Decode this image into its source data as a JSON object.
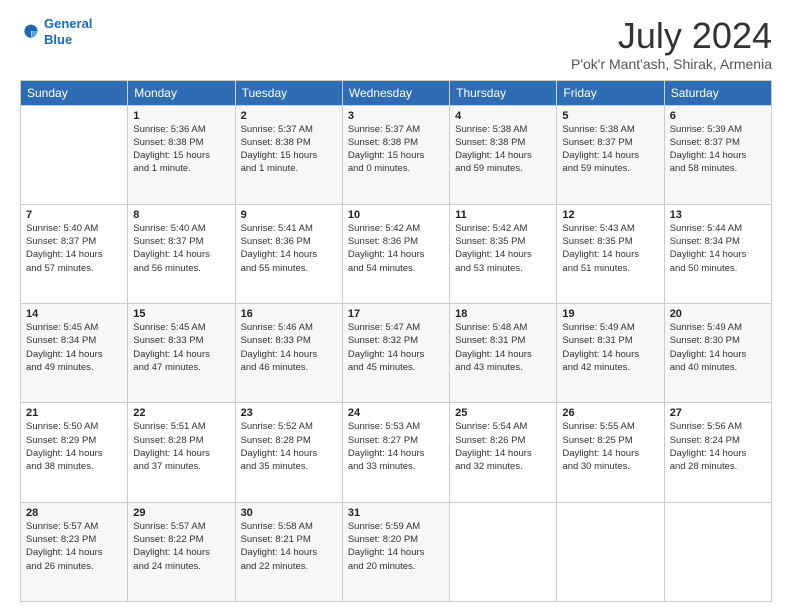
{
  "logo": {
    "line1": "General",
    "line2": "Blue"
  },
  "title": "July 2024",
  "subtitle": "P'ok'r Mant'ash, Shirak, Armenia",
  "days_of_week": [
    "Sunday",
    "Monday",
    "Tuesday",
    "Wednesday",
    "Thursday",
    "Friday",
    "Saturday"
  ],
  "weeks": [
    [
      {
        "day": "",
        "sunrise": "",
        "sunset": "",
        "daylight": ""
      },
      {
        "day": "1",
        "sunrise": "Sunrise: 5:36 AM",
        "sunset": "Sunset: 8:38 PM",
        "daylight": "Daylight: 15 hours and 1 minute."
      },
      {
        "day": "2",
        "sunrise": "Sunrise: 5:37 AM",
        "sunset": "Sunset: 8:38 PM",
        "daylight": "Daylight: 15 hours and 1 minute."
      },
      {
        "day": "3",
        "sunrise": "Sunrise: 5:37 AM",
        "sunset": "Sunset: 8:38 PM",
        "daylight": "Daylight: 15 hours and 0 minutes."
      },
      {
        "day": "4",
        "sunrise": "Sunrise: 5:38 AM",
        "sunset": "Sunset: 8:38 PM",
        "daylight": "Daylight: 14 hours and 59 minutes."
      },
      {
        "day": "5",
        "sunrise": "Sunrise: 5:38 AM",
        "sunset": "Sunset: 8:37 PM",
        "daylight": "Daylight: 14 hours and 59 minutes."
      },
      {
        "day": "6",
        "sunrise": "Sunrise: 5:39 AM",
        "sunset": "Sunset: 8:37 PM",
        "daylight": "Daylight: 14 hours and 58 minutes."
      }
    ],
    [
      {
        "day": "7",
        "sunrise": "Sunrise: 5:40 AM",
        "sunset": "Sunset: 8:37 PM",
        "daylight": "Daylight: 14 hours and 57 minutes."
      },
      {
        "day": "8",
        "sunrise": "Sunrise: 5:40 AM",
        "sunset": "Sunset: 8:37 PM",
        "daylight": "Daylight: 14 hours and 56 minutes."
      },
      {
        "day": "9",
        "sunrise": "Sunrise: 5:41 AM",
        "sunset": "Sunset: 8:36 PM",
        "daylight": "Daylight: 14 hours and 55 minutes."
      },
      {
        "day": "10",
        "sunrise": "Sunrise: 5:42 AM",
        "sunset": "Sunset: 8:36 PM",
        "daylight": "Daylight: 14 hours and 54 minutes."
      },
      {
        "day": "11",
        "sunrise": "Sunrise: 5:42 AM",
        "sunset": "Sunset: 8:35 PM",
        "daylight": "Daylight: 14 hours and 53 minutes."
      },
      {
        "day": "12",
        "sunrise": "Sunrise: 5:43 AM",
        "sunset": "Sunset: 8:35 PM",
        "daylight": "Daylight: 14 hours and 51 minutes."
      },
      {
        "day": "13",
        "sunrise": "Sunrise: 5:44 AM",
        "sunset": "Sunset: 8:34 PM",
        "daylight": "Daylight: 14 hours and 50 minutes."
      }
    ],
    [
      {
        "day": "14",
        "sunrise": "Sunrise: 5:45 AM",
        "sunset": "Sunset: 8:34 PM",
        "daylight": "Daylight: 14 hours and 49 minutes."
      },
      {
        "day": "15",
        "sunrise": "Sunrise: 5:45 AM",
        "sunset": "Sunset: 8:33 PM",
        "daylight": "Daylight: 14 hours and 47 minutes."
      },
      {
        "day": "16",
        "sunrise": "Sunrise: 5:46 AM",
        "sunset": "Sunset: 8:33 PM",
        "daylight": "Daylight: 14 hours and 46 minutes."
      },
      {
        "day": "17",
        "sunrise": "Sunrise: 5:47 AM",
        "sunset": "Sunset: 8:32 PM",
        "daylight": "Daylight: 14 hours and 45 minutes."
      },
      {
        "day": "18",
        "sunrise": "Sunrise: 5:48 AM",
        "sunset": "Sunset: 8:31 PM",
        "daylight": "Daylight: 14 hours and 43 minutes."
      },
      {
        "day": "19",
        "sunrise": "Sunrise: 5:49 AM",
        "sunset": "Sunset: 8:31 PM",
        "daylight": "Daylight: 14 hours and 42 minutes."
      },
      {
        "day": "20",
        "sunrise": "Sunrise: 5:49 AM",
        "sunset": "Sunset: 8:30 PM",
        "daylight": "Daylight: 14 hours and 40 minutes."
      }
    ],
    [
      {
        "day": "21",
        "sunrise": "Sunrise: 5:50 AM",
        "sunset": "Sunset: 8:29 PM",
        "daylight": "Daylight: 14 hours and 38 minutes."
      },
      {
        "day": "22",
        "sunrise": "Sunrise: 5:51 AM",
        "sunset": "Sunset: 8:28 PM",
        "daylight": "Daylight: 14 hours and 37 minutes."
      },
      {
        "day": "23",
        "sunrise": "Sunrise: 5:52 AM",
        "sunset": "Sunset: 8:28 PM",
        "daylight": "Daylight: 14 hours and 35 minutes."
      },
      {
        "day": "24",
        "sunrise": "Sunrise: 5:53 AM",
        "sunset": "Sunset: 8:27 PM",
        "daylight": "Daylight: 14 hours and 33 minutes."
      },
      {
        "day": "25",
        "sunrise": "Sunrise: 5:54 AM",
        "sunset": "Sunset: 8:26 PM",
        "daylight": "Daylight: 14 hours and 32 minutes."
      },
      {
        "day": "26",
        "sunrise": "Sunrise: 5:55 AM",
        "sunset": "Sunset: 8:25 PM",
        "daylight": "Daylight: 14 hours and 30 minutes."
      },
      {
        "day": "27",
        "sunrise": "Sunrise: 5:56 AM",
        "sunset": "Sunset: 8:24 PM",
        "daylight": "Daylight: 14 hours and 28 minutes."
      }
    ],
    [
      {
        "day": "28",
        "sunrise": "Sunrise: 5:57 AM",
        "sunset": "Sunset: 8:23 PM",
        "daylight": "Daylight: 14 hours and 26 minutes."
      },
      {
        "day": "29",
        "sunrise": "Sunrise: 5:57 AM",
        "sunset": "Sunset: 8:22 PM",
        "daylight": "Daylight: 14 hours and 24 minutes."
      },
      {
        "day": "30",
        "sunrise": "Sunrise: 5:58 AM",
        "sunset": "Sunset: 8:21 PM",
        "daylight": "Daylight: 14 hours and 22 minutes."
      },
      {
        "day": "31",
        "sunrise": "Sunrise: 5:59 AM",
        "sunset": "Sunset: 8:20 PM",
        "daylight": "Daylight: 14 hours and 20 minutes."
      },
      {
        "day": "",
        "sunrise": "",
        "sunset": "",
        "daylight": ""
      },
      {
        "day": "",
        "sunrise": "",
        "sunset": "",
        "daylight": ""
      },
      {
        "day": "",
        "sunrise": "",
        "sunset": "",
        "daylight": ""
      }
    ]
  ]
}
